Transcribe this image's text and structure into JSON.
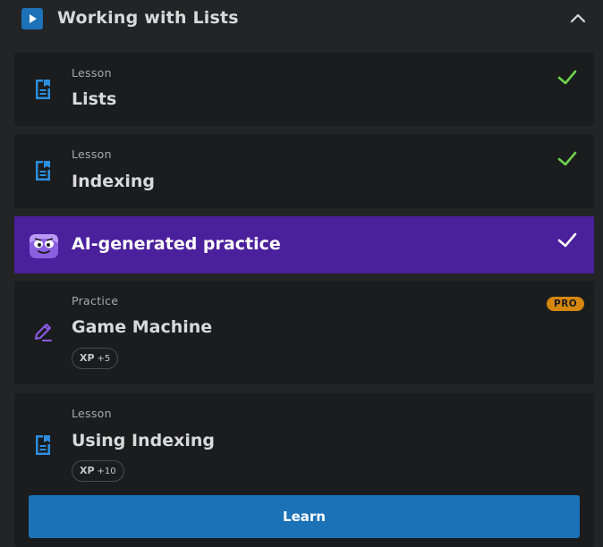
{
  "section": {
    "title": "Working with Lists",
    "icon": "play-icon",
    "collapse_icon": "chevron-up-icon"
  },
  "items": [
    {
      "kind": "Lesson",
      "name": "Lists",
      "status": "completed",
      "icon": "document-icon"
    },
    {
      "kind": "Lesson",
      "name": "Indexing",
      "status": "completed",
      "icon": "document-icon"
    },
    {
      "kind": "",
      "name": "AI-generated practice",
      "status": "completed",
      "icon": "robot-mascot-icon"
    },
    {
      "kind": "Practice",
      "name": "Game Machine",
      "badge": "PRO",
      "xp_label": "XP",
      "xp_value": "+5",
      "icon": "pencil-icon"
    },
    {
      "kind": "Lesson",
      "name": "Using Indexing",
      "xp_label": "XP",
      "xp_value": "+10",
      "icon": "document-icon",
      "action_label": "Learn"
    }
  ],
  "colors": {
    "background": "#232426",
    "card": "#1b1c1e",
    "ai_card": "#4b209c",
    "accent_blue": "#1c72b6",
    "check_green": "#6fd34d",
    "pro_badge": "#d4870c",
    "icon_purple": "#8c5ce6"
  }
}
